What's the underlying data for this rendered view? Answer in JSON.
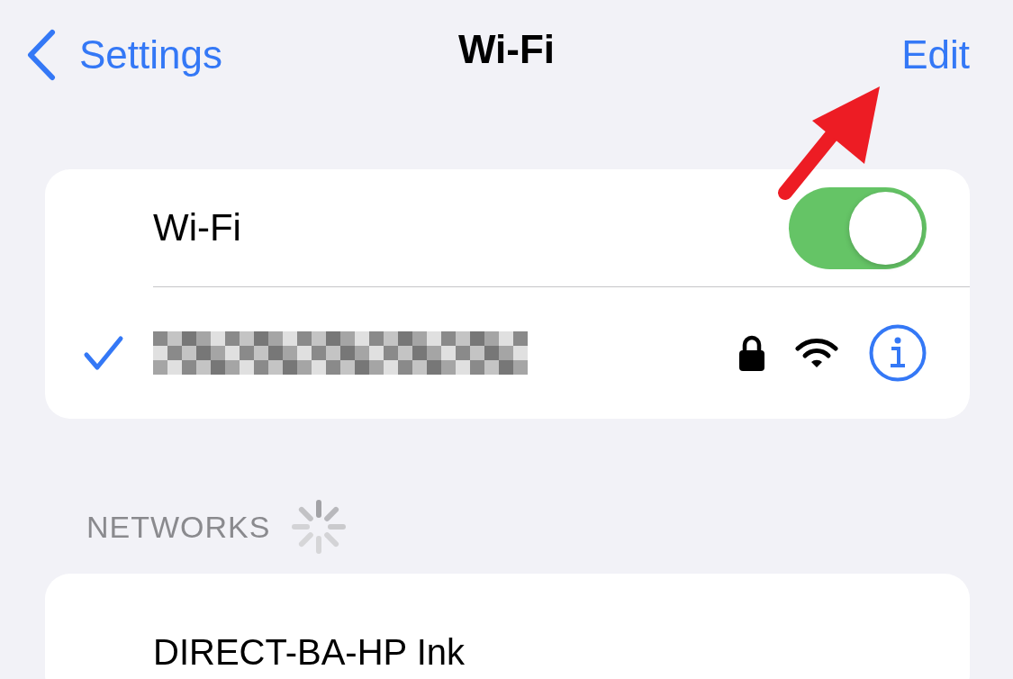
{
  "nav": {
    "back_label": "Settings",
    "title": "Wi-Fi",
    "action": "Edit"
  },
  "wifi_toggle": {
    "label": "Wi-Fi",
    "on": true
  },
  "current_network": {
    "connected": true,
    "redacted": true,
    "locked": true
  },
  "networks_section": {
    "header": "NETWORKS",
    "searching": true
  },
  "networks": [
    {
      "name": "DIRECT-BA-HP Ink"
    }
  ],
  "annotation": {
    "kind": "arrow"
  }
}
